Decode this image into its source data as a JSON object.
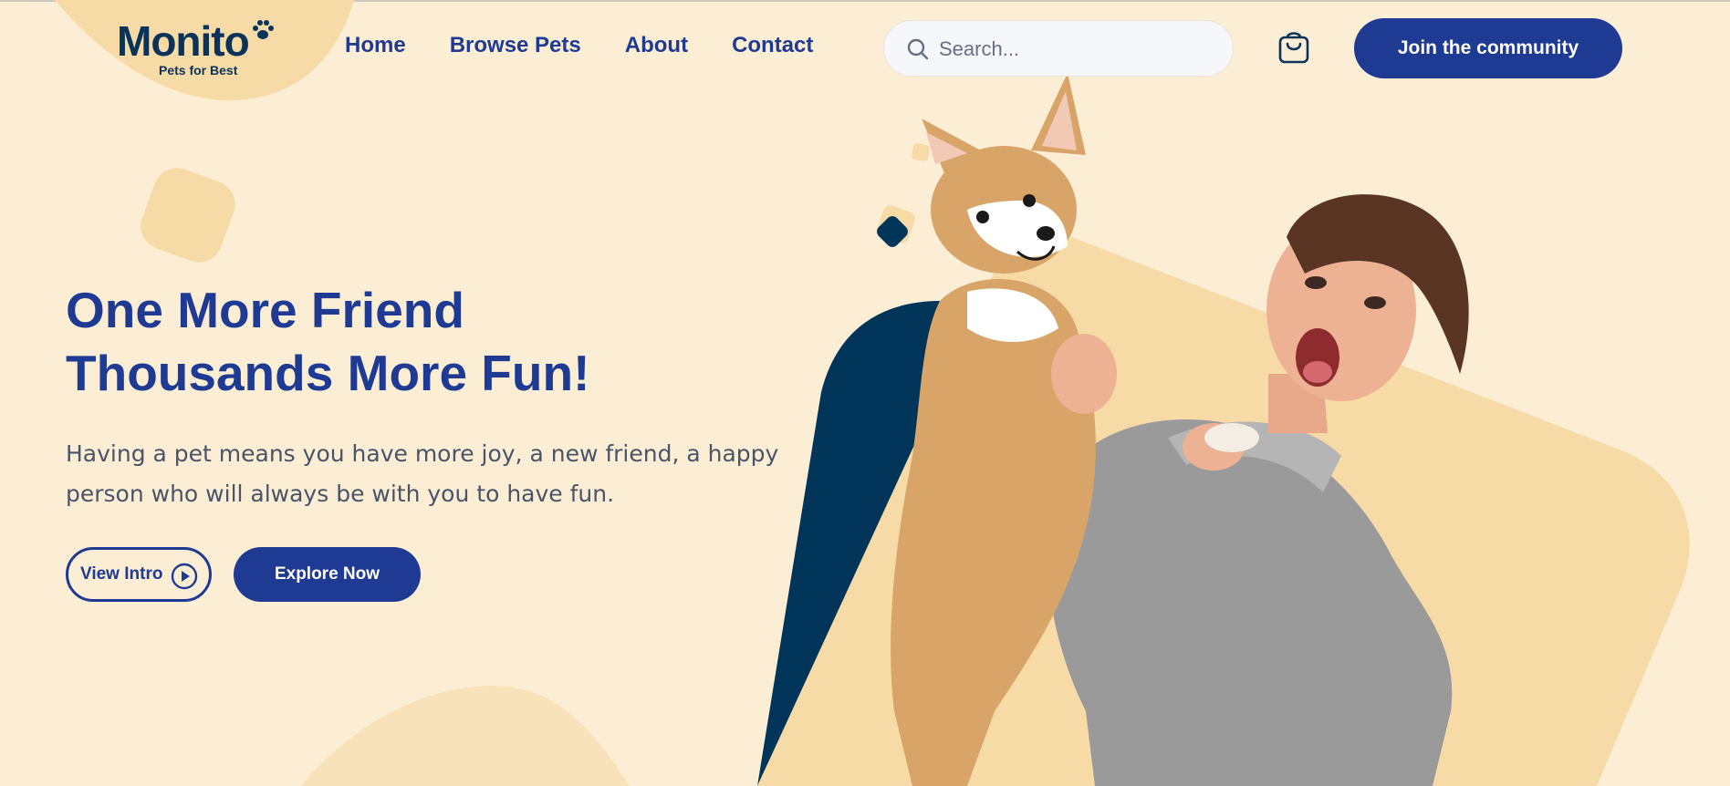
{
  "brand": {
    "name": "Monito",
    "tagline": "Pets for Best"
  },
  "nav": {
    "items": [
      {
        "label": "Home"
      },
      {
        "label": "Browse Pets"
      },
      {
        "label": "About"
      },
      {
        "label": "Contact"
      }
    ]
  },
  "search": {
    "placeholder": "Search..."
  },
  "header": {
    "join_label": "Join the community"
  },
  "hero": {
    "title_line1": "One More Friend",
    "title_line2": "Thousands More Fun!",
    "description": "Having a pet means you have more joy, a new friend, a happy person who will always be with you to have fun.",
    "view_intro_label": "View Intro",
    "explore_label": "Explore Now"
  },
  "colors": {
    "background": "#FCEED5",
    "primary": "#1F3A93",
    "navy": "#003459",
    "accent_sand": "#F7DBA7"
  },
  "icons": [
    "paw-icon",
    "search-icon",
    "shopping-bag-icon",
    "play-icon"
  ]
}
